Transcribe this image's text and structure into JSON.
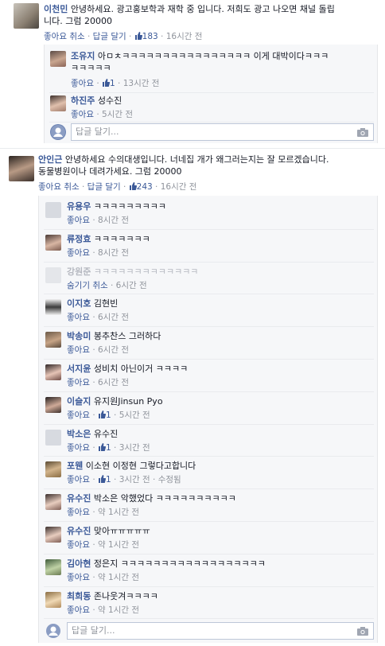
{
  "threads": [
    {
      "author": "이천민",
      "text1": " 안녕하세요. 광고홍보학과 재학 중 입니다. 저희도 광고 나오면 채널 돌립",
      "text2": "니다. 그럼 20000",
      "actions": {
        "like": "좋아요 취소",
        "reply": "답글 달기",
        "likes": "183",
        "time": "16시간 전"
      },
      "replies": [
        {
          "author": "조유지",
          "text": " 아ㅁㅊㅋㅋㅋㅋㅋㅋㅋㅋㅋㅋㅋㅋㅋㅋㅋㅋ 이게 대박이다ㅋㅋㅋ",
          "text2": "ㅋㅋㅋㅋㅋ",
          "like": "좋아요",
          "likes": "1",
          "time": "13시간 전"
        },
        {
          "author": "하진주",
          "text": " 성수진",
          "like": "좋아요",
          "time": "5시간 전"
        }
      ],
      "reply_placeholder": "답글 달기..."
    },
    {
      "author": "안인근",
      "text1": " 안녕하세요 수의대생입니다. 너네집 개가 왜그러는지는 잘 모르겠습니다.",
      "text2": "동물병원이나 데려가세요. 그럼 20000",
      "actions": {
        "like": "좋아요 취소",
        "reply": "답글 달기",
        "likes": "243",
        "time": "16시간 전"
      },
      "replies": [
        {
          "author": "유용우",
          "text": " ㅋㅋㅋㅋㅋㅋㅋㅋㅋ",
          "like": "좋아요",
          "time": "8시간 전"
        },
        {
          "author": "류정효",
          "text": " ㅋㅋㅋㅋㅋㅋㅋ",
          "like": "좋아요",
          "time": "8시간 전"
        },
        {
          "author": "강원준",
          "text": " ㅋㅋㅋㅋㅋㅋㅋㅋㅋㅋㅋㅋㅋ",
          "like": "숨기기 취소",
          "time": "6시간 전",
          "grayed": true
        },
        {
          "author": "이지호",
          "text": " 김현빈",
          "like": "좋아요",
          "time": "6시간 전"
        },
        {
          "author": "박송미",
          "text": " 봉추찬스 그러하다",
          "like": "좋아요",
          "time": "6시간 전"
        },
        {
          "author": "서지윤",
          "text": " 성비치 아닌이거 ㅋㅋㅋㅋ",
          "like": "좋아요",
          "time": "6시간 전"
        },
        {
          "author": "이슬지",
          "text": " 유지원Jinsun Pyo",
          "like": "좋아요",
          "likes": "1",
          "time": "5시간 전"
        },
        {
          "author": "박소은",
          "text": " 유수진",
          "like": "좋아요",
          "likes": "1",
          "time": "3시간 전"
        },
        {
          "author": "포웬",
          "text": " 이소현 이정현 그렇다고합니다",
          "like": "좋아요",
          "likes": "1",
          "time": "3시간 전",
          "edited": "수정됨"
        },
        {
          "author": "유수진",
          "text": " 박소은 악했었다 ㅋㅋㅋㅋㅋㅋㅋㅋㅋㅋ",
          "like": "좋아요",
          "time": "약 1시간 전"
        },
        {
          "author": "유수진",
          "text": " 맞아ㅠㅠㅠㅠㅠ",
          "like": "좋아요",
          "time": "약 1시간 전"
        },
        {
          "author": "김아현",
          "text": " 정은지 ㅋㅋㅋㅋㅋㅋㅋㅋㅋㅋㅋㅋㅋㅋㅋㅋㅋㅋ",
          "like": "좋아요",
          "time": "약 1시간 전"
        },
        {
          "author": "최희동",
          "text": " 존나웃겨ㅋㅋㅋㅋ",
          "like": "좋아요",
          "time": "약 1시간 전"
        }
      ],
      "reply_placeholder": "답글 달기..."
    }
  ],
  "separator": " · ",
  "colors": {
    "link": "#3b5998",
    "meta": "#90949c",
    "reply_bg": "#f6f7f9"
  }
}
